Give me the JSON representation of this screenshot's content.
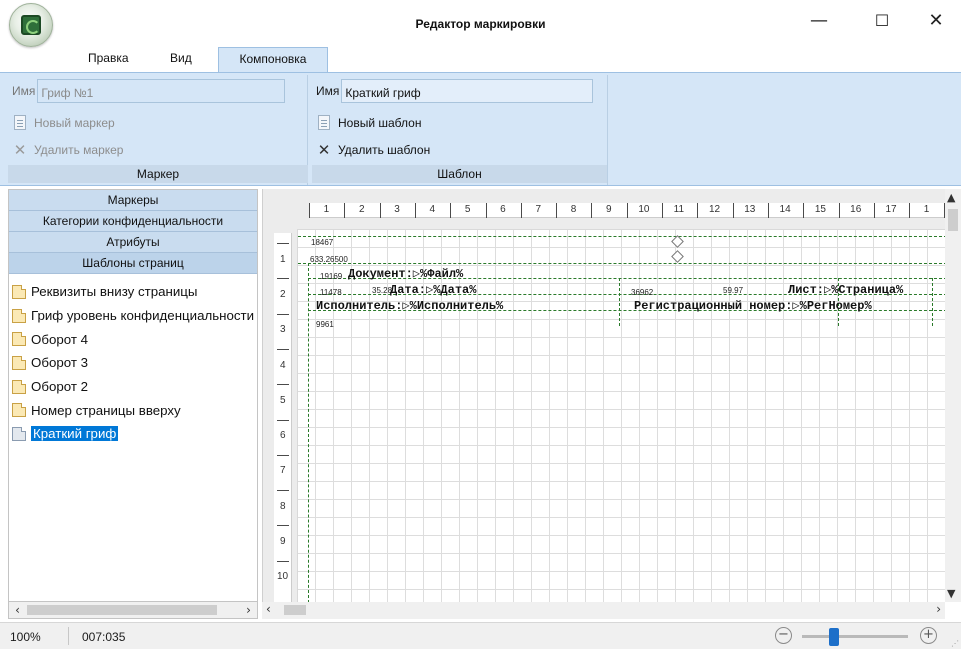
{
  "window": {
    "title": "Редактор маркировки",
    "minimize": "—",
    "maximize": "☐",
    "close": "✕"
  },
  "menu": {
    "tabs": [
      "Правка",
      "Вид",
      "Компоновка"
    ],
    "active_tab": "Компоновка"
  },
  "ribbon": {
    "marker_group": {
      "name_label": "Имя",
      "name_value": "Гриф №1",
      "new_button": "Новый маркер",
      "delete_button": "Удалить маркер",
      "title": "Маркер"
    },
    "template_group": {
      "name_label": "Имя",
      "name_value": "Краткий гриф",
      "new_button": "Новый шаблон",
      "delete_button": "Удалить шаблон",
      "title": "Шаблон"
    }
  },
  "sidebar": {
    "categories": [
      "Маркеры",
      "Категории конфиденциальности",
      "Атрибуты",
      "Шаблоны страниц"
    ],
    "items": [
      {
        "label": "Реквизиты внизу страницы"
      },
      {
        "label": "Гриф уровень конфиденциальности"
      },
      {
        "label": "Оборот 4"
      },
      {
        "label": "Оборот 3"
      },
      {
        "label": "Оборот 2"
      },
      {
        "label": "Номер страницы вверху"
      },
      {
        "label": "Краткий гриф",
        "selected": true
      }
    ]
  },
  "ruler": {
    "horizontal": [
      "1",
      "2",
      "3",
      "4",
      "5",
      "6",
      "7",
      "8",
      "9",
      "10",
      "11",
      "12",
      "13",
      "14",
      "15",
      "16",
      "17",
      "1"
    ],
    "vertical": [
      "1",
      "2",
      "3",
      "4",
      "5",
      "6",
      "7",
      "8",
      "9",
      "10"
    ]
  },
  "canvas": {
    "notes": [
      "18467",
      "633.26500",
      "19169",
      "11478",
      "35.28",
      "36962",
      "59.97",
      "9961"
    ],
    "fields": [
      {
        "text": "Документ:▷%Файл%"
      },
      {
        "text": "Дата:▷%Дата%"
      },
      {
        "text": "Исполнитель:▷%Исполнитель%"
      },
      {
        "text": "Лист:▷%Страница%"
      },
      {
        "text": "Регистрационный номер:▷%РегНомер%"
      }
    ]
  },
  "status": {
    "zoom": "100%",
    "position": "007:035",
    "zoom_minus": "−",
    "zoom_plus": "+",
    "zoom_level": 0.3
  },
  "colors": {
    "ribbon_bg": "#d5e6f7",
    "selection": "#0078d7",
    "guide_lines": "#2a7a2a"
  }
}
